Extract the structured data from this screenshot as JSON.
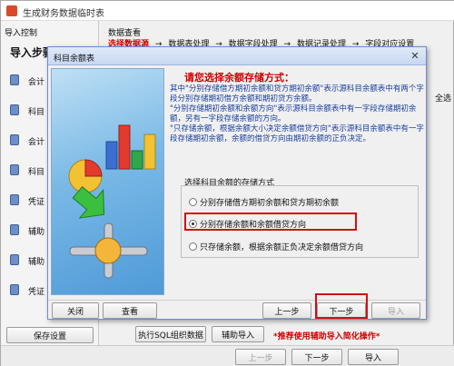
{
  "window": {
    "title": "生成财务数据临时表"
  },
  "left": {
    "header": "导入控制",
    "steps_title": "导入步骤.",
    "steps": [
      "会计",
      "科目",
      "会计",
      "科目",
      "凭证",
      "辅助",
      "辅助",
      "凭证"
    ],
    "save_button": "保存设置"
  },
  "right": {
    "title": "数据查看",
    "wizard": [
      "选择数据源",
      "→",
      "数据表处理",
      "→",
      "数据字段处理",
      "→",
      "数据记录处理",
      "→",
      "字段对应设置"
    ],
    "select_all": "全选",
    "exec_sql_button": "执行SQL组织数据",
    "aux_import_button": "辅助导入",
    "note": "*推荐使用辅助导入简化操作*"
  },
  "bottom": {
    "prev": "上一步",
    "next": "下一步",
    "import": "导入"
  },
  "dialog": {
    "title": "科目余额表",
    "close_icon": "close-icon",
    "heading": "请您选择余额存储方式：",
    "desc": [
      "其中\"分别存储借方期初余额和贷方期初余额\"表示源科目余额表中有两个字段分别存储期初借方余额和期初贷方余额。",
      "\"分别存储期初余额和余额方向\"表示源科目余额表中有一字段存储期初余额，另有一字段存储余额的方向。",
      "\"只存储余额，根据余额大小决定余额借贷方向\"表示源科目余额表中有一字段存储期初余额，余额的借贷方向由期初余额的正负决定。"
    ],
    "group_title": "选择科目余额的存储方式",
    "options": [
      "分别存储借方期初余额和贷方期初余额",
      "分别存储余额和余额借贷方向",
      "只存储余额，根据余额正负决定余额借贷方向"
    ],
    "selected_index": 1,
    "close_button": "关闭",
    "view_button": "查看",
    "prev_button": "上一步",
    "next_button": "下一步",
    "import_button": "导入",
    "highlight_color": "#d01010"
  }
}
